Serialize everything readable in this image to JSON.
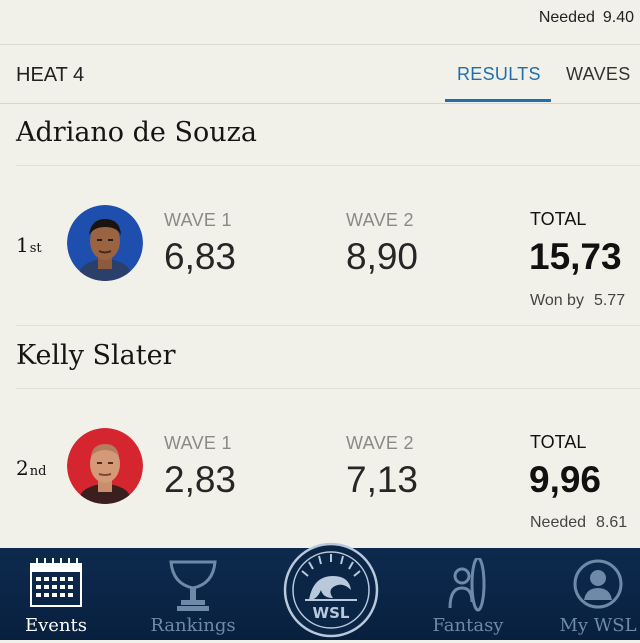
{
  "top_status": {
    "needed_label": "Needed",
    "needed_value": "9.40"
  },
  "heat": {
    "title": "HEAT 4",
    "tabs": [
      {
        "label": "RESULTS",
        "active": true
      },
      {
        "label": "WAVES",
        "active": false
      }
    ]
  },
  "results": [
    {
      "name": "Adriano de Souza",
      "place": "1",
      "place_suffix": "st",
      "wave1_label": "WAVE 1",
      "wave1_score": "6,83",
      "wave2_label": "WAVE 2",
      "wave2_score": "8,90",
      "total_label": "TOTAL",
      "total_score": "15,73",
      "note_label": "Won by",
      "note_value": "5.77",
      "avatar_color": "#1f4fae"
    },
    {
      "name": "Kelly Slater",
      "place": "2",
      "place_suffix": "nd",
      "wave1_label": "WAVE 1",
      "wave1_score": "2,83",
      "wave2_label": "WAVE 2",
      "wave2_score": "7,13",
      "total_label": "TOTAL",
      "total_score": "9,96",
      "note_label": "Needed",
      "note_value": "8.61",
      "avatar_color": "#d52630"
    }
  ],
  "nav": {
    "items": [
      {
        "label": "Events",
        "icon": "calendar-icon",
        "active": true
      },
      {
        "label": "Rankings",
        "icon": "trophy-icon",
        "active": false
      },
      {
        "label": "Fantasy",
        "icon": "surfer-icon",
        "active": false
      },
      {
        "label": "My WSL",
        "icon": "profile-icon",
        "active": false
      }
    ],
    "logo_text": "WSL"
  },
  "colors": {
    "accent": "#1f6fb0",
    "nav_bg": "#0b2547",
    "background": "#f1f1ea"
  }
}
